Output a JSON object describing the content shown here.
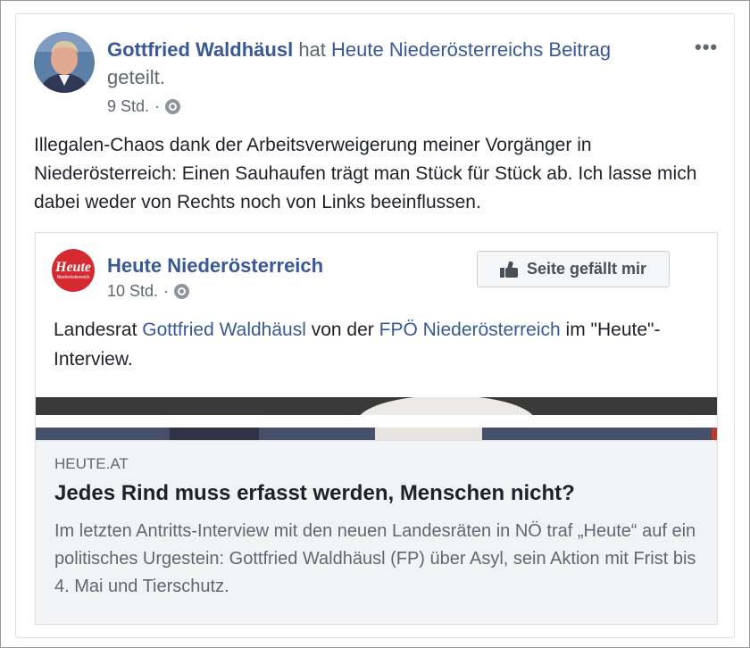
{
  "post": {
    "author": "Gottfried Waldhäusl",
    "shared_word": "hat",
    "page_link": "Heute Niederösterreichs",
    "post_link": "Beitrag",
    "suffix": "geteilt.",
    "time": "9 Std.",
    "separator": "·",
    "text": "Illegalen-Chaos dank der Arbeitsverweigerung meiner Vorgänger in Niederösterreich: Einen Sauhaufen trägt man Stück für Stück ab. Ich lasse mich dabei weder von Rechts noch von Links beeinflussen.",
    "more_label": "•••"
  },
  "shared": {
    "logo_text": "Heute",
    "logo_subtext": "Niederösterreich",
    "page_name": "Heute Niederösterreich",
    "time": "10 Std.",
    "separator": "·",
    "like_button": "Seite gefällt mir",
    "text_prefix": "Landesrat",
    "text_link1": "Gottfried Waldhäusl",
    "text_middle": "von der",
    "text_link2": "FPÖ Niederösterreich",
    "text_suffix": "im \"Heute\"-Interview."
  },
  "link": {
    "domain": "HEUTE.AT",
    "title": "Jedes Rind muss erfasst werden, Menschen nicht?",
    "description": "Im letzten Antritts-Interview mit den neuen Landesräten in NÖ traf „Heute“ auf ein politisches Urgestein: Gottfried Waldhäusl (FP) über Asyl, sein Aktion mit Frist bis 4. Mai und Tierschutz."
  },
  "icons": {
    "audience": "globe-icon",
    "like": "thumbs-up-icon",
    "more": "more-options-icon"
  },
  "colors": {
    "link": "#385898",
    "meta": "#606770",
    "brand_red": "#d52a32"
  }
}
